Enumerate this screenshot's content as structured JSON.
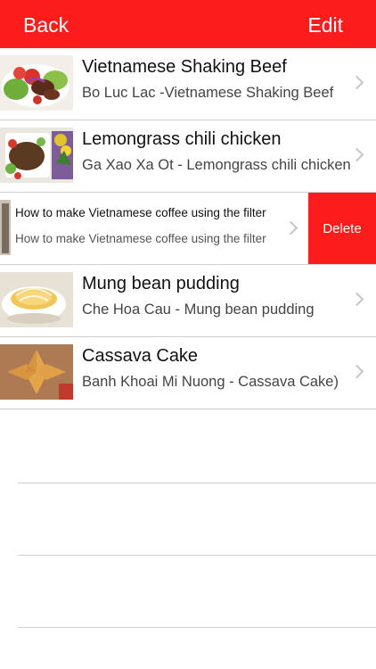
{
  "navbar": {
    "back_label": "Back",
    "edit_label": "Edit",
    "background": "#fc1c1c"
  },
  "recipes": [
    {
      "title": "Vietnamese Shaking Beef",
      "subtitle": "Bo Luc Lac -Vietnamese Shaking Beef"
    },
    {
      "title": "Lemongrass chili chicken",
      "subtitle": "Ga Xao Xa Ot - Lemongrass chili chicken"
    },
    {
      "title": "How to make Vietnamese coffee using the filter",
      "subtitle": "How to make Vietnamese coffee using the filter",
      "swiped": true
    },
    {
      "title": "Mung bean pudding",
      "subtitle": "Che Hoa Cau - Mung bean pudding"
    },
    {
      "title": "Cassava Cake",
      "subtitle": "Banh Khoai Mi Nuong - Cassava Cake)"
    }
  ],
  "swipe_action": {
    "delete_label": "Delete",
    "color": "#fc1c1c"
  },
  "icons": {
    "disclosure": "chevron-right-icon"
  }
}
